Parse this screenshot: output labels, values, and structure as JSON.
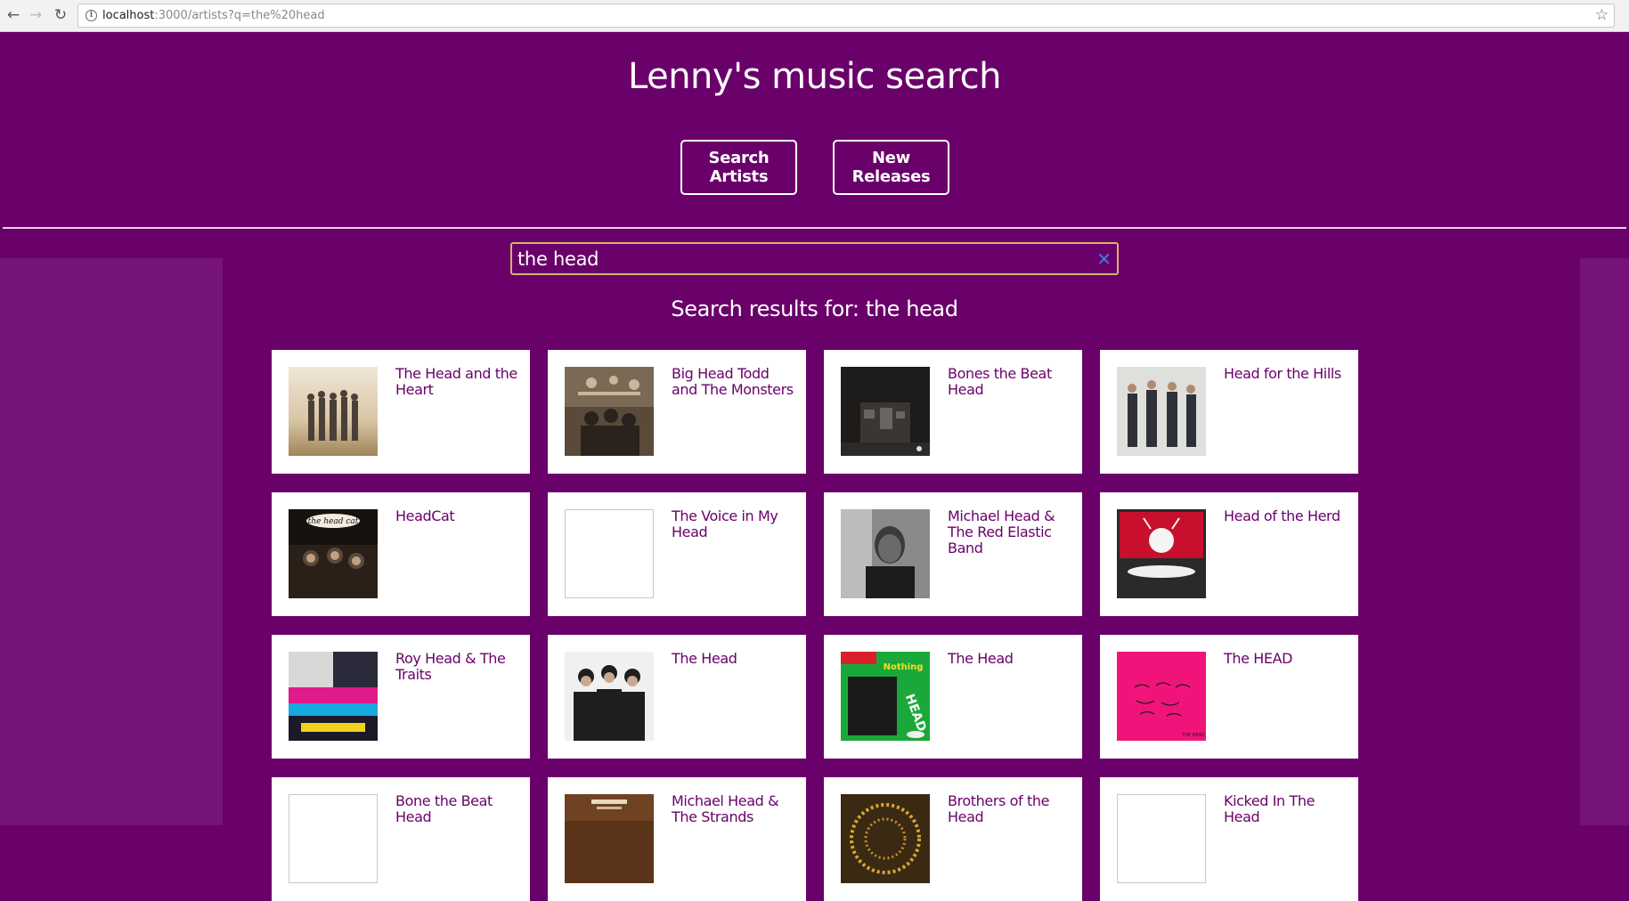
{
  "browser": {
    "url_host": "localhost",
    "url_rest": ":3000/artists?q=the%20head"
  },
  "header": {
    "title": "Lenny's music search",
    "nav": [
      {
        "label": "Search Artists"
      },
      {
        "label": "New Releases"
      }
    ]
  },
  "search": {
    "value": "the head",
    "results_heading": "Search results for: the head"
  },
  "results": [
    {
      "name": "The Head and the Heart",
      "has_image": true,
      "thumb": "band-beach"
    },
    {
      "name": "Big Head Todd and The Monsters",
      "has_image": true,
      "thumb": "band-room"
    },
    {
      "name": "Bones the Beat Head",
      "has_image": true,
      "thumb": "dark-garage"
    },
    {
      "name": "Head for the Hills",
      "has_image": true,
      "thumb": "band-white"
    },
    {
      "name": "HeadCat",
      "has_image": true,
      "thumb": "headcat-cover"
    },
    {
      "name": "The Voice in My Head",
      "has_image": false,
      "thumb": "none"
    },
    {
      "name": "Michael Head & The Red Elastic Band",
      "has_image": true,
      "thumb": "portrait-bw"
    },
    {
      "name": "Head of the Herd",
      "has_image": true,
      "thumb": "herd-cover"
    },
    {
      "name": "Roy Head & The Traits",
      "has_image": true,
      "thumb": "roy-head-cover"
    },
    {
      "name": "The Head",
      "has_image": true,
      "thumb": "trio-bw"
    },
    {
      "name": "The Head",
      "has_image": true,
      "thumb": "green-cover"
    },
    {
      "name": "The HEAD",
      "has_image": true,
      "thumb": "pink-cover"
    },
    {
      "name": "Bone the Beat Head",
      "has_image": false,
      "thumb": "none"
    },
    {
      "name": "Michael Head & The Strands",
      "has_image": true,
      "thumb": "brown-cover"
    },
    {
      "name": "Brothers of the Head",
      "has_image": true,
      "thumb": "gold-cover"
    },
    {
      "name": "Kicked In The Head",
      "has_image": false,
      "thumb": "none"
    }
  ],
  "colors": {
    "background": "#6a006a",
    "side_panel": "#75137a",
    "card_text": "#6a006a",
    "search_border": "#d8b36a",
    "clear_icon": "#3b7fd9"
  }
}
